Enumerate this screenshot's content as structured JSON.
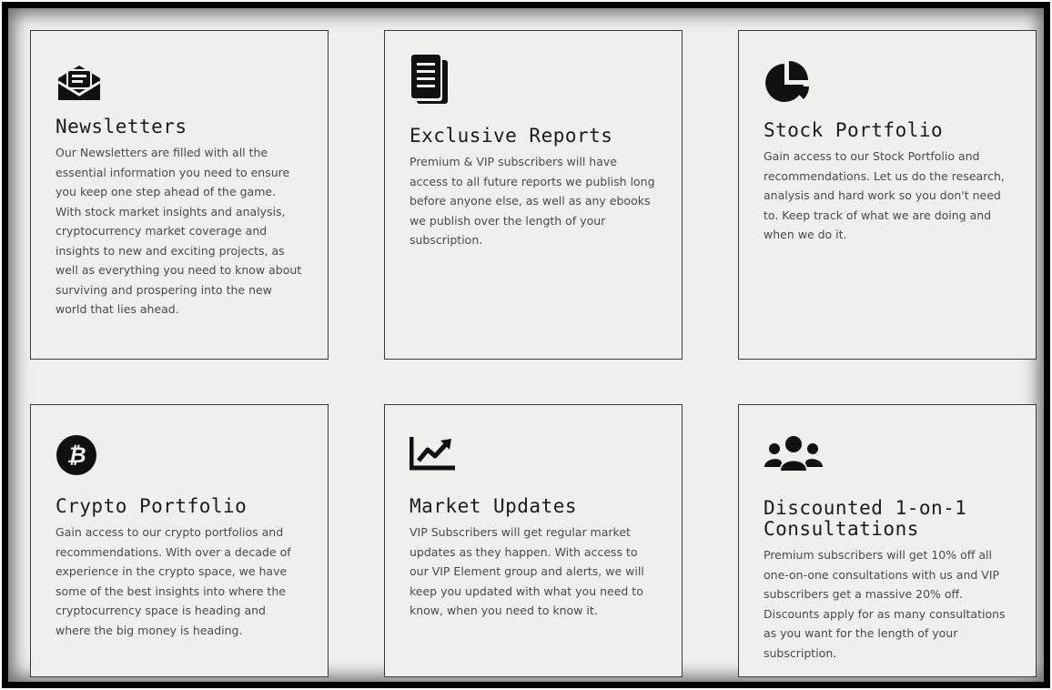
{
  "cards": [
    {
      "icon": "envelope-open-text-icon",
      "title": "Newsletters",
      "description": "Our Newsletters are filled with all the essential information you need to ensure you keep one step ahead of the game. With stock market insights and analysis, cryptocurrency market coverage and insights to new and exciting projects, as well as everything you need to know about surviving and prospering into the new world that lies ahead."
    },
    {
      "icon": "documents-icon",
      "title": "Exclusive Reports",
      "description": "Premium & VIP subscribers will have access to all future reports we publish long before anyone else, as well as any ebooks we publish over the length of your subscription."
    },
    {
      "icon": "pie-chart-icon",
      "title": "Stock Portfolio",
      "description": "Gain access to our Stock Portfolio and recommendations. Let us do the research, analysis and hard work so you don't need to. Keep track of what we are doing and when we do it."
    },
    {
      "icon": "bitcoin-icon",
      "title": "Crypto Portfolio",
      "description": "Gain access to our crypto portfolios and recommendations. With over a decade of experience in the crypto space, we have some of the best insights into where the cryptocurrency space is heading and where the big money is heading."
    },
    {
      "icon": "chart-line-icon",
      "title": "Market Updates",
      "description": "VIP Subscribers will get regular market updates as they happen. With access to our VIP Element group and alerts, we will keep you updated with what you need to know, when you need to know it."
    },
    {
      "icon": "users-icon",
      "title": "Discounted 1-on-1 Consultations",
      "description": "Premium subscribers will get 10% off all one-on-one consultations with us and VIP subscribers get a massive 20% off. Discounts apply for as many consultations as you want for the length of your subscription."
    }
  ],
  "colors": {
    "background": "#f1efec",
    "icon": "#111111",
    "title": "#1b1b1b",
    "text": "#4a4a4a"
  }
}
